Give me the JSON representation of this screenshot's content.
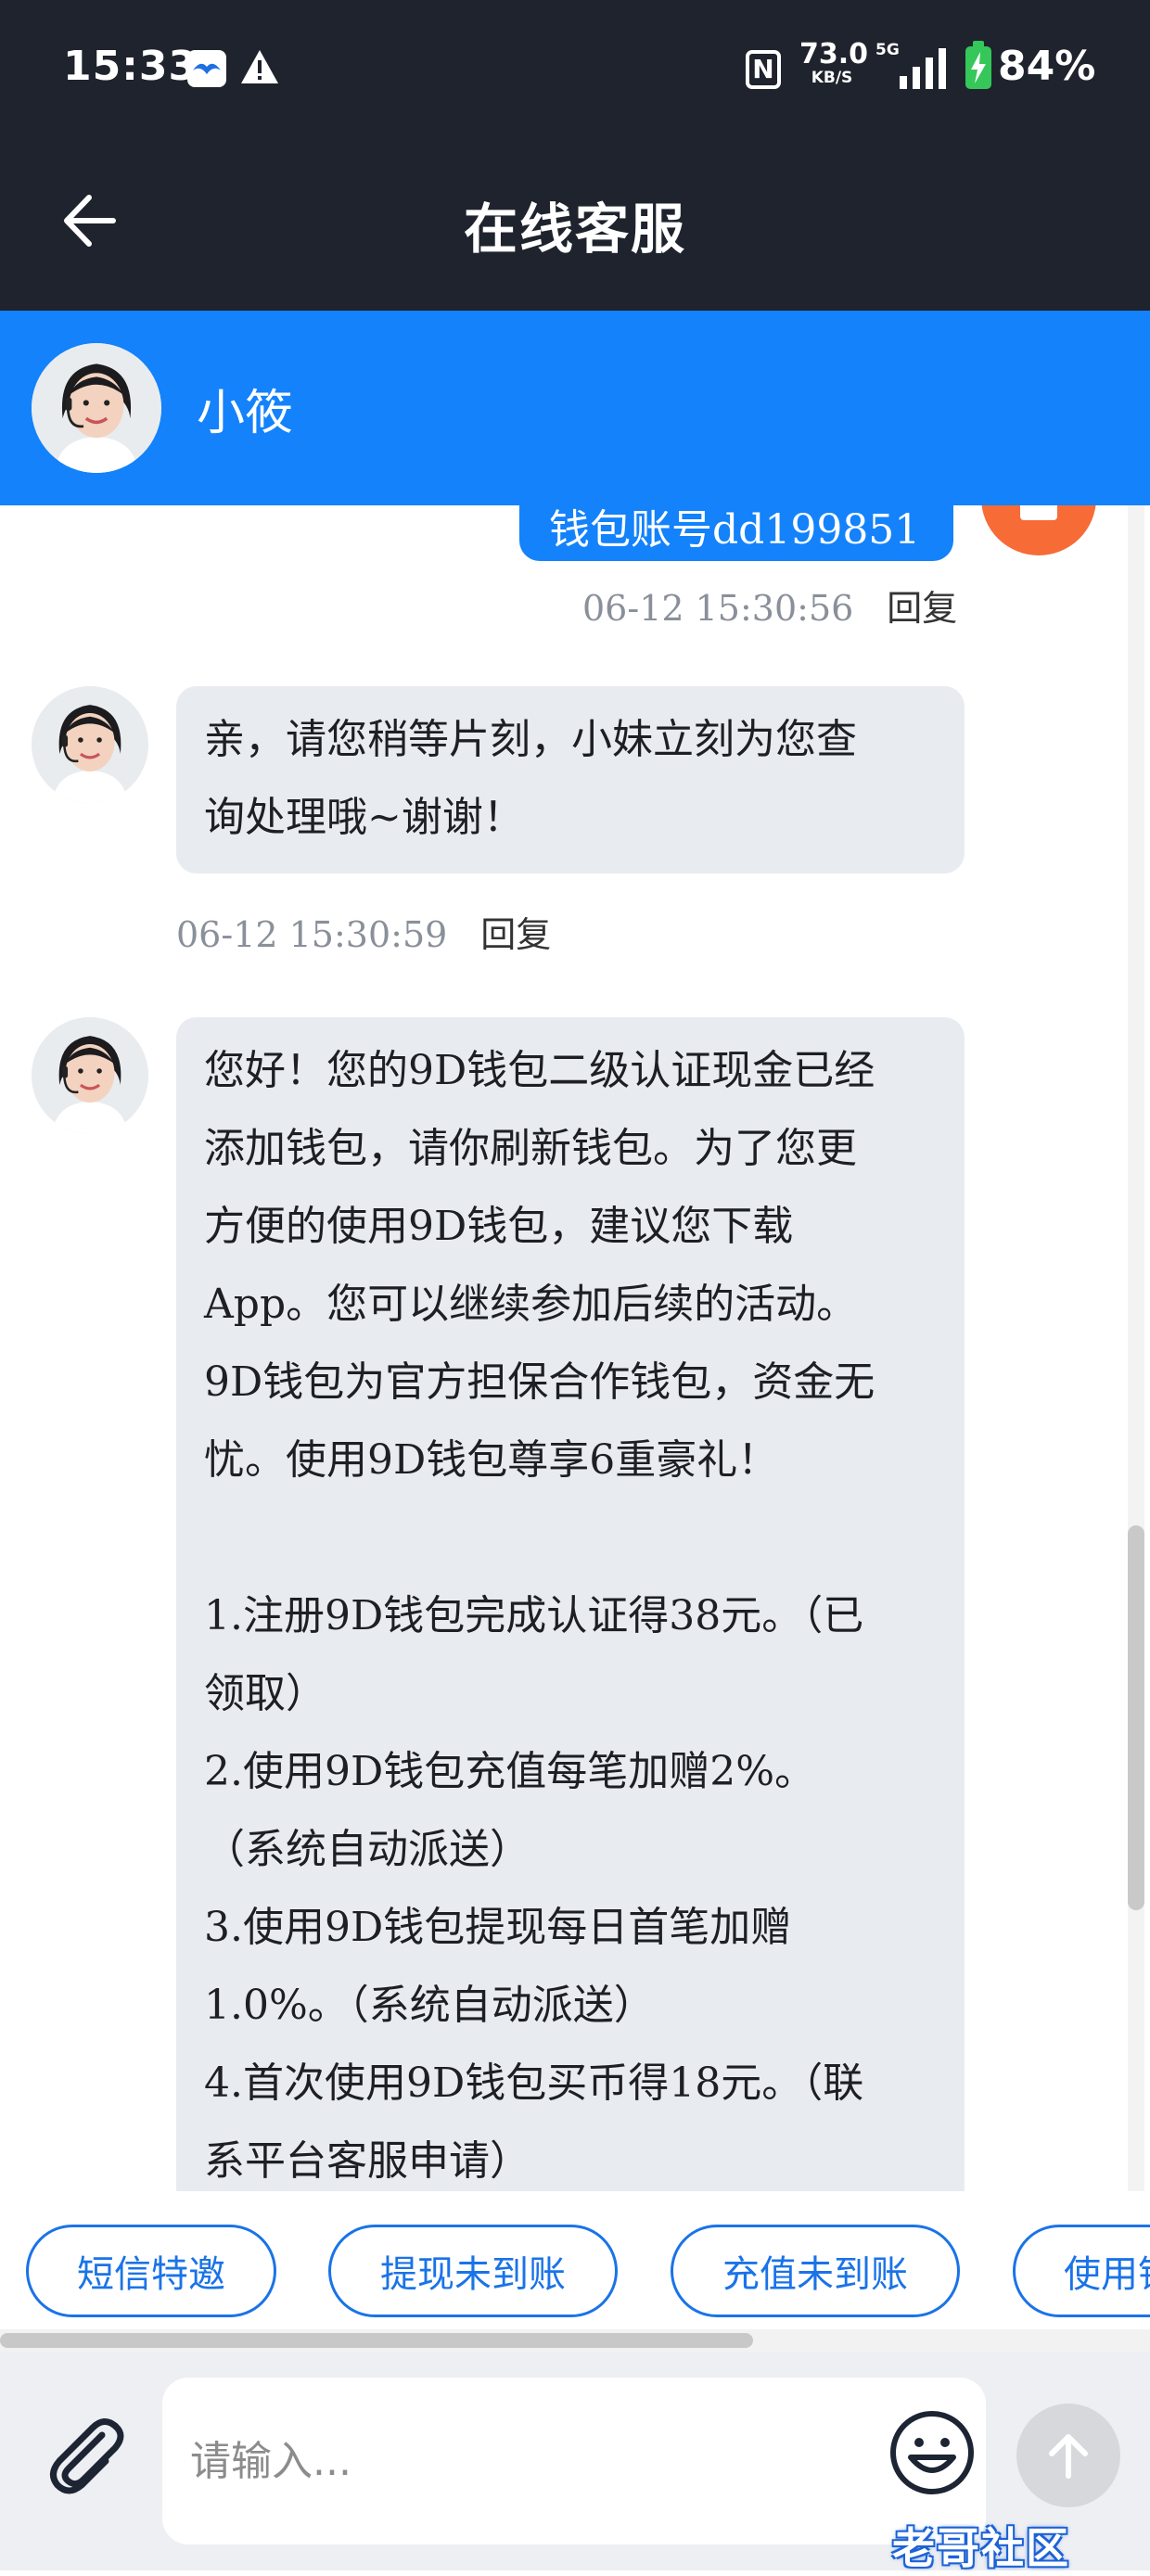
{
  "status_bar": {
    "time": "15:33",
    "net_speed": "73.0",
    "net_unit": "KB/S",
    "network_type": "5G",
    "battery": "84%",
    "icons": [
      "app-notification-icon",
      "warning-icon",
      "nfc-icon",
      "signal-icon",
      "battery-charging-icon"
    ]
  },
  "header": {
    "title": "在线客服",
    "back_icon": "arrow-left-icon"
  },
  "agent": {
    "name": "小筱"
  },
  "messages": [
    {
      "side": "outgoing",
      "text_fragment": "钱包账号dd199851",
      "time": "06-12 15:30:56",
      "reply_label": "回复"
    },
    {
      "side": "incoming",
      "lines": [
        "亲，请您稍等片刻，小妹立刻为您查",
        "询处理哦~谢谢！"
      ],
      "time": "06-12 15:30:59",
      "reply_label": "回复"
    },
    {
      "side": "incoming",
      "lines": [
        "您好！您的9D钱包二级认证现金已经",
        "添加钱包，请你刷新钱包。为了您更",
        "方便的使用9D钱包，建议您下载",
        "App。您可以继续参加后续的活动。",
        "9D钱包为官方担保合作钱包，资金无",
        "忧。使用9D钱包尊享6重豪礼！",
        "",
        "1.注册9D钱包完成认证得38元。（已",
        "领取）",
        "2.使用9D钱包充值每笔加赠2%。",
        "（系统自动派送）",
        "3.使用9D钱包提现每日首笔加赠",
        "1.0%。（系统自动派送）",
        "4.首次使用9D钱包买币得18元。（联",
        "系平台客服申请）"
      ]
    }
  ],
  "quick_replies": [
    "短信特邀",
    "提现未到账",
    "充值未到账",
    "使用钱"
  ],
  "input": {
    "placeholder": "请输入..."
  },
  "watermark": "老哥社区",
  "colors": {
    "header_bg": "#1e232d",
    "accent": "#1382fb",
    "bubble_bg": "#e8ebf0",
    "chip_border": "#1a73e8"
  }
}
